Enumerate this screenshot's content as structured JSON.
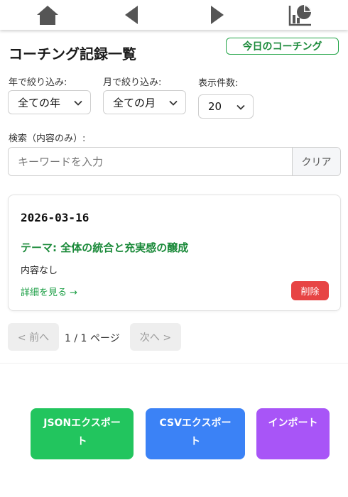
{
  "nav": {
    "home_icon": "home-icon",
    "back_icon": "arrow-left-icon",
    "forward_icon": "arrow-right-icon",
    "stats_icon": "chart-icon"
  },
  "header": {
    "title": "コーチング記録一覧",
    "today_button": "今日のコーチング"
  },
  "filters": {
    "year_label": "年で絞り込み:",
    "year_value": "全ての年",
    "month_label": "月で絞り込み:",
    "month_value": "全ての月",
    "count_label": "表示件数:",
    "count_value": "20"
  },
  "search": {
    "label": "検索（内容のみ）:",
    "placeholder": "キーワードを入力",
    "value": "",
    "clear_label": "クリア"
  },
  "records": [
    {
      "date": "2026-03-16",
      "theme": "テーマ: 全体の統合と充実感の醸成",
      "content": "内容なし",
      "detail_link": "詳細を見る →",
      "delete_label": "削除"
    }
  ],
  "pagination": {
    "prev_label": "< 前へ",
    "page_info": "1 / 1 ページ",
    "next_label": "次へ >"
  },
  "export": {
    "json_label": "JSONエクスポート",
    "csv_label": "CSVエクスポート",
    "import_label": "インポート"
  },
  "colors": {
    "accent_green": "#22c55e",
    "accent_blue": "#3b82f6",
    "accent_purple": "#a855f7",
    "danger": "#e74444"
  }
}
